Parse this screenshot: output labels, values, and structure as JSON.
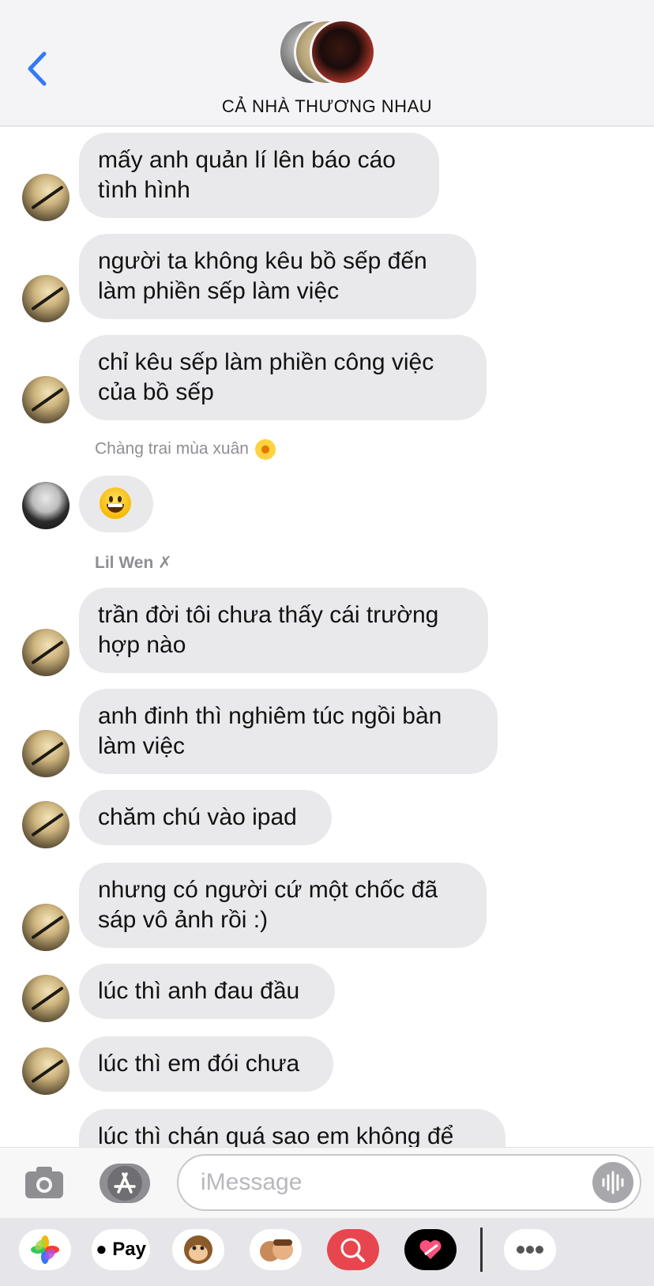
{
  "header": {
    "group_name": "CẢ NHÀ THƯƠNG NHAU"
  },
  "messages": [
    {
      "text": "mấy anh quản lí lên báo cáo tình hình"
    },
    {
      "text": "người ta không kêu bồ sếp đến làm phiền sếp làm việc"
    },
    {
      "text": "chỉ kêu sếp làm phiền công việc của bồ sếp"
    },
    {
      "sender": "Chàng trai mùa xuân",
      "sender_icon": "sunflower-emoji"
    },
    {
      "emoji": "grinning-face-emoji"
    },
    {
      "sender": "Lil Wen ✗"
    },
    {
      "text": "trần đời tôi chưa thấy cái trường hợp nào"
    },
    {
      "text": "anh đinh thì nghiêm túc ngồi bàn làm việc"
    },
    {
      "text": "chăm chú vào ipad"
    },
    {
      "text": "nhưng có người cứ một chốc đã sáp vô ảnh rồi :)"
    },
    {
      "text": "lúc thì anh đau đầu"
    },
    {
      "text": "lúc thì em đói chưa"
    },
    {
      "text": "lúc thì chán quá sao em không để"
    }
  ],
  "input": {
    "placeholder": "iMessage"
  },
  "app_drawer": {
    "pay_label": " Pay"
  },
  "colors": {
    "accent": "#3478f6",
    "bubble": "#e9e9eb",
    "header_bg": "#f4f4f6"
  }
}
